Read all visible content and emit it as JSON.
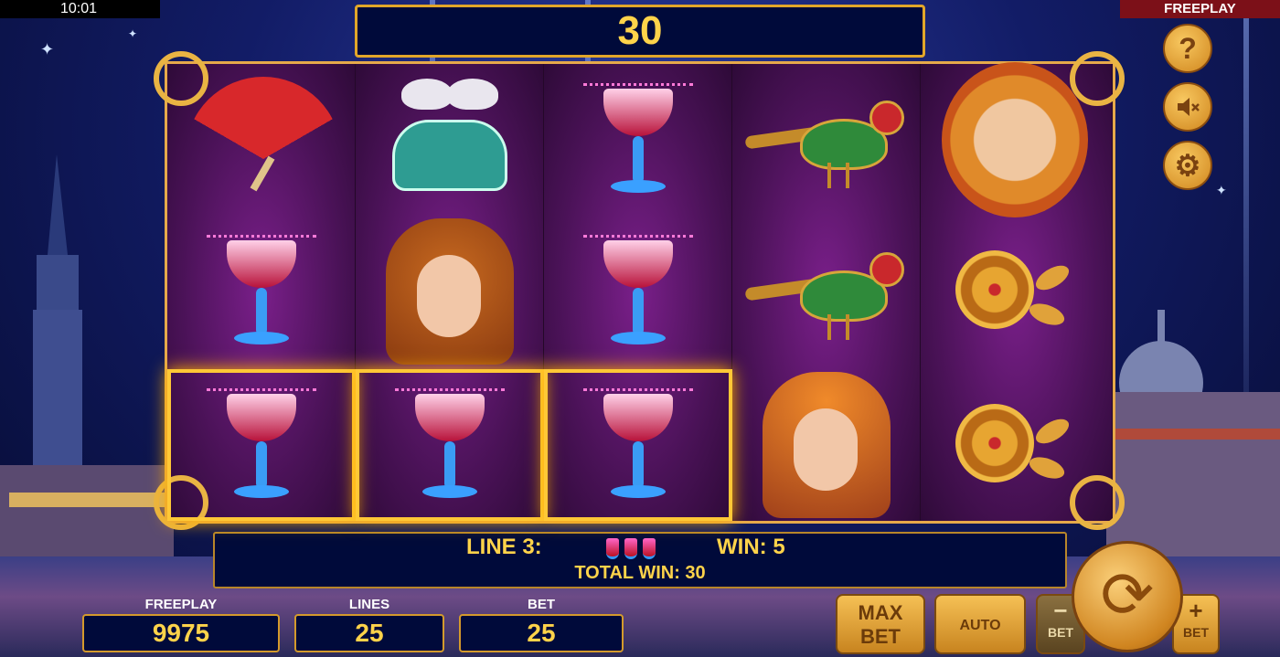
{
  "status_bar": {
    "time": "10:01",
    "mode": "FREEPLAY"
  },
  "win_display": {
    "value": "30"
  },
  "side_buttons": {
    "help_icon": "?",
    "sound_icon": "speaker-muted-icon",
    "settings_icon": "gear-icon"
  },
  "reels": [
    [
      "fan",
      "cup",
      "cup"
    ],
    [
      "jewel-box",
      "lady-redhead",
      "cup"
    ],
    [
      "cup",
      "cup",
      "cup"
    ],
    [
      "bird",
      "bird",
      "lady-flower-crown"
    ],
    [
      "mask",
      "rose",
      "rose"
    ]
  ],
  "winning_cells": [
    [
      0,
      2
    ],
    [
      1,
      2
    ],
    [
      2,
      2
    ]
  ],
  "win_info": {
    "line_label": "LINE 3:",
    "win_label": "WIN: 5",
    "total_label": "TOTAL WIN: 30"
  },
  "stats": {
    "freeplay_label": "FREEPLAY",
    "freeplay_value": "9975",
    "lines_label": "LINES",
    "lines_value": "25",
    "bet_label": "BET",
    "bet_value": "25"
  },
  "controls": {
    "max_bet_line1": "MAX",
    "max_bet_line2": "BET",
    "auto_label": "AUTO",
    "bet_minus_label": "BET",
    "bet_plus_label": "BET",
    "minus_symbol": "−",
    "plus_symbol": "+",
    "spin_symbol": "⟳"
  },
  "colors": {
    "accent_gold": "#ffd34a",
    "frame_gold": "#e6a94a",
    "panel": "#000a3a",
    "reel_purple": "#4a1257"
  }
}
